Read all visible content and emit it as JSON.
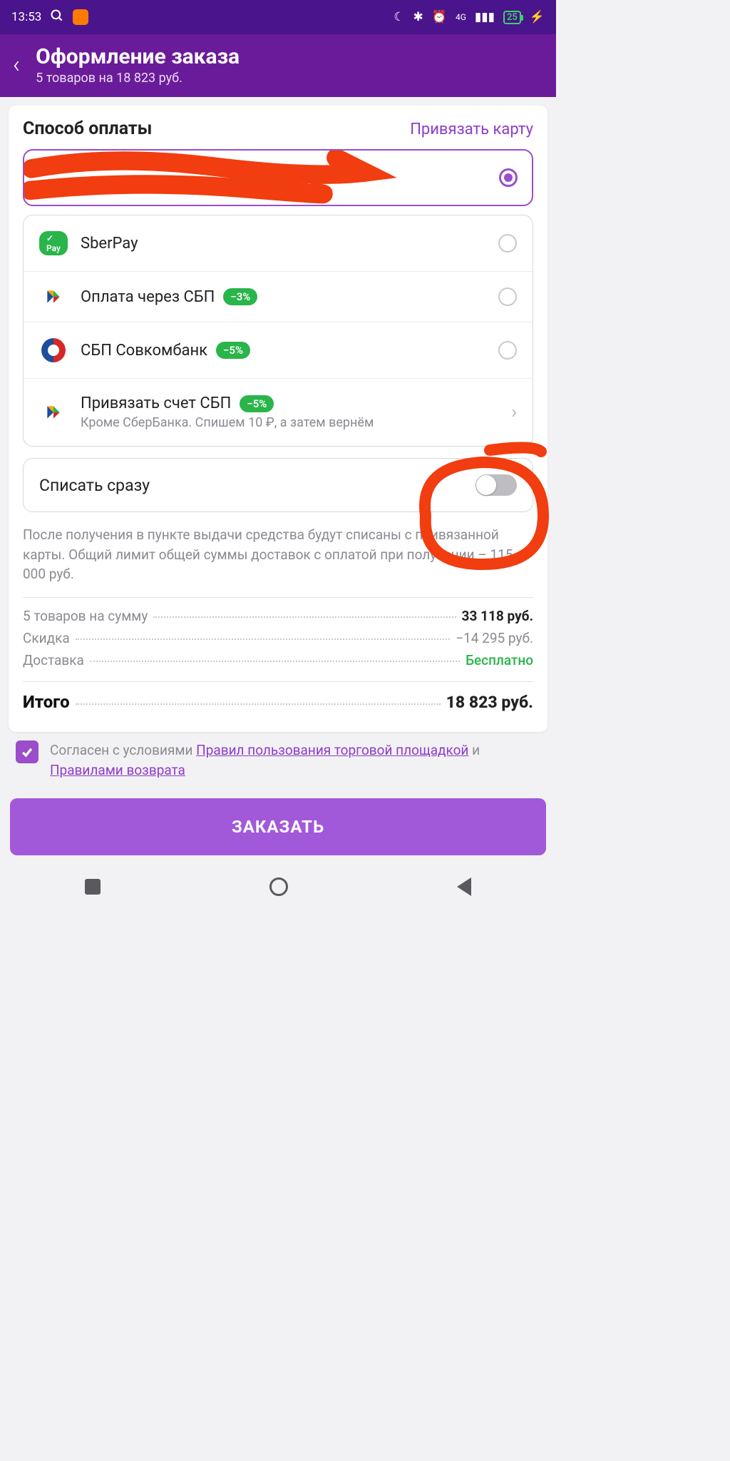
{
  "status": {
    "time": "13:53",
    "network": "4G",
    "battery": "25"
  },
  "header": {
    "title": "Оформление заказа",
    "subtitle": "5 товаров на 18 823 руб."
  },
  "section": {
    "title": "Способ оплаты",
    "link": "Привязать карту"
  },
  "options": {
    "sberpay": {
      "label": "SberPay",
      "badge": "✓ Pay"
    },
    "sbp": {
      "label": "Оплата через СБП",
      "discount": "−3%"
    },
    "sovcom": {
      "label": "СБП Совкомбанк",
      "discount": "−5%"
    },
    "link_sbp": {
      "label": "Привязать счет СБП",
      "discount": "−5%",
      "sub": "Кроме СберБанка. Спишем 10 ₽, а затем вернём"
    }
  },
  "toggle": {
    "label": "Списать сразу"
  },
  "info": "После получения в пункте выдачи средства будут списаны с привязанной карты. Общий лимит общей суммы доставок с оплатой при получении – 115 000 руб.",
  "summary": {
    "items_label": "5 товаров на сумму",
    "items_value": "33 118 руб.",
    "discount_label": "Скидка",
    "discount_value": "−14 295 руб.",
    "delivery_label": "Доставка",
    "delivery_value": "Бесплатно",
    "total_label": "Итого",
    "total_value": "18 823 руб."
  },
  "agree": {
    "prefix": "Согласен с условиями ",
    "link1": "Правил пользования торговой площадкой",
    "mid": " и ",
    "link2": "Правилами возврата"
  },
  "order_button": "ЗАКАЗАТЬ"
}
